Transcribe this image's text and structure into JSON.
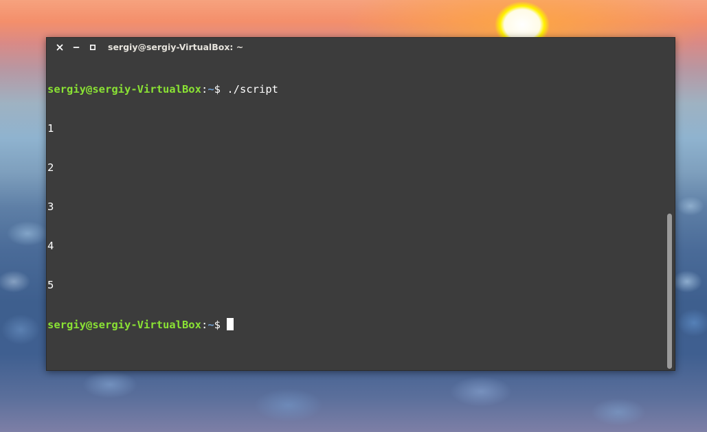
{
  "window": {
    "title": "sergiy@sergiy-VirtualBox: ~",
    "controls": {
      "close_icon": "close-icon",
      "minimize_icon": "minimize-icon",
      "maximize_icon": "maximize-icon"
    }
  },
  "terminal": {
    "prompt_user": "sergiy@sergiy-VirtualBox",
    "prompt_sep": ":",
    "prompt_path": "~",
    "prompt_symbol": "$ ",
    "command": "./script",
    "output": [
      "1",
      "2",
      "3",
      "4",
      "5"
    ]
  },
  "scrollbar": {
    "position_fraction": 0.5
  },
  "colors": {
    "terminal_bg": "#3c3c3c",
    "prompt_user": "#8ae234",
    "prompt_path": "#729fcf",
    "text": "#ffffff"
  }
}
